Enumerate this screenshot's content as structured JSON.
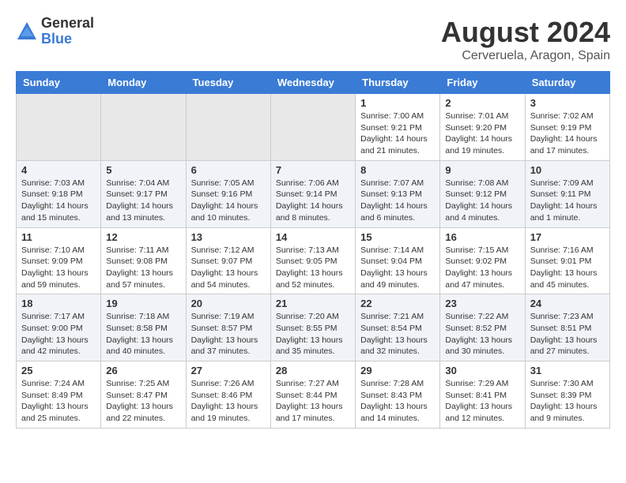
{
  "logo": {
    "general": "General",
    "blue": "Blue"
  },
  "title": "August 2024",
  "location": "Cerveruela, Aragon, Spain",
  "days_of_week": [
    "Sunday",
    "Monday",
    "Tuesday",
    "Wednesday",
    "Thursday",
    "Friday",
    "Saturday"
  ],
  "weeks": [
    {
      "days": [
        {
          "number": "",
          "info": ""
        },
        {
          "number": "",
          "info": ""
        },
        {
          "number": "",
          "info": ""
        },
        {
          "number": "",
          "info": ""
        },
        {
          "number": "1",
          "info": "Sunrise: 7:00 AM\nSunset: 9:21 PM\nDaylight: 14 hours\nand 21 minutes."
        },
        {
          "number": "2",
          "info": "Sunrise: 7:01 AM\nSunset: 9:20 PM\nDaylight: 14 hours\nand 19 minutes."
        },
        {
          "number": "3",
          "info": "Sunrise: 7:02 AM\nSunset: 9:19 PM\nDaylight: 14 hours\nand 17 minutes."
        }
      ]
    },
    {
      "days": [
        {
          "number": "4",
          "info": "Sunrise: 7:03 AM\nSunset: 9:18 PM\nDaylight: 14 hours\nand 15 minutes."
        },
        {
          "number": "5",
          "info": "Sunrise: 7:04 AM\nSunset: 9:17 PM\nDaylight: 14 hours\nand 13 minutes."
        },
        {
          "number": "6",
          "info": "Sunrise: 7:05 AM\nSunset: 9:16 PM\nDaylight: 14 hours\nand 10 minutes."
        },
        {
          "number": "7",
          "info": "Sunrise: 7:06 AM\nSunset: 9:14 PM\nDaylight: 14 hours\nand 8 minutes."
        },
        {
          "number": "8",
          "info": "Sunrise: 7:07 AM\nSunset: 9:13 PM\nDaylight: 14 hours\nand 6 minutes."
        },
        {
          "number": "9",
          "info": "Sunrise: 7:08 AM\nSunset: 9:12 PM\nDaylight: 14 hours\nand 4 minutes."
        },
        {
          "number": "10",
          "info": "Sunrise: 7:09 AM\nSunset: 9:11 PM\nDaylight: 14 hours\nand 1 minute."
        }
      ]
    },
    {
      "days": [
        {
          "number": "11",
          "info": "Sunrise: 7:10 AM\nSunset: 9:09 PM\nDaylight: 13 hours\nand 59 minutes."
        },
        {
          "number": "12",
          "info": "Sunrise: 7:11 AM\nSunset: 9:08 PM\nDaylight: 13 hours\nand 57 minutes."
        },
        {
          "number": "13",
          "info": "Sunrise: 7:12 AM\nSunset: 9:07 PM\nDaylight: 13 hours\nand 54 minutes."
        },
        {
          "number": "14",
          "info": "Sunrise: 7:13 AM\nSunset: 9:05 PM\nDaylight: 13 hours\nand 52 minutes."
        },
        {
          "number": "15",
          "info": "Sunrise: 7:14 AM\nSunset: 9:04 PM\nDaylight: 13 hours\nand 49 minutes."
        },
        {
          "number": "16",
          "info": "Sunrise: 7:15 AM\nSunset: 9:02 PM\nDaylight: 13 hours\nand 47 minutes."
        },
        {
          "number": "17",
          "info": "Sunrise: 7:16 AM\nSunset: 9:01 PM\nDaylight: 13 hours\nand 45 minutes."
        }
      ]
    },
    {
      "days": [
        {
          "number": "18",
          "info": "Sunrise: 7:17 AM\nSunset: 9:00 PM\nDaylight: 13 hours\nand 42 minutes."
        },
        {
          "number": "19",
          "info": "Sunrise: 7:18 AM\nSunset: 8:58 PM\nDaylight: 13 hours\nand 40 minutes."
        },
        {
          "number": "20",
          "info": "Sunrise: 7:19 AM\nSunset: 8:57 PM\nDaylight: 13 hours\nand 37 minutes."
        },
        {
          "number": "21",
          "info": "Sunrise: 7:20 AM\nSunset: 8:55 PM\nDaylight: 13 hours\nand 35 minutes."
        },
        {
          "number": "22",
          "info": "Sunrise: 7:21 AM\nSunset: 8:54 PM\nDaylight: 13 hours\nand 32 minutes."
        },
        {
          "number": "23",
          "info": "Sunrise: 7:22 AM\nSunset: 8:52 PM\nDaylight: 13 hours\nand 30 minutes."
        },
        {
          "number": "24",
          "info": "Sunrise: 7:23 AM\nSunset: 8:51 PM\nDaylight: 13 hours\nand 27 minutes."
        }
      ]
    },
    {
      "days": [
        {
          "number": "25",
          "info": "Sunrise: 7:24 AM\nSunset: 8:49 PM\nDaylight: 13 hours\nand 25 minutes."
        },
        {
          "number": "26",
          "info": "Sunrise: 7:25 AM\nSunset: 8:47 PM\nDaylight: 13 hours\nand 22 minutes."
        },
        {
          "number": "27",
          "info": "Sunrise: 7:26 AM\nSunset: 8:46 PM\nDaylight: 13 hours\nand 19 minutes."
        },
        {
          "number": "28",
          "info": "Sunrise: 7:27 AM\nSunset: 8:44 PM\nDaylight: 13 hours\nand 17 minutes."
        },
        {
          "number": "29",
          "info": "Sunrise: 7:28 AM\nSunset: 8:43 PM\nDaylight: 13 hours\nand 14 minutes."
        },
        {
          "number": "30",
          "info": "Sunrise: 7:29 AM\nSunset: 8:41 PM\nDaylight: 13 hours\nand 12 minutes."
        },
        {
          "number": "31",
          "info": "Sunrise: 7:30 AM\nSunset: 8:39 PM\nDaylight: 13 hours\nand 9 minutes."
        }
      ]
    }
  ]
}
